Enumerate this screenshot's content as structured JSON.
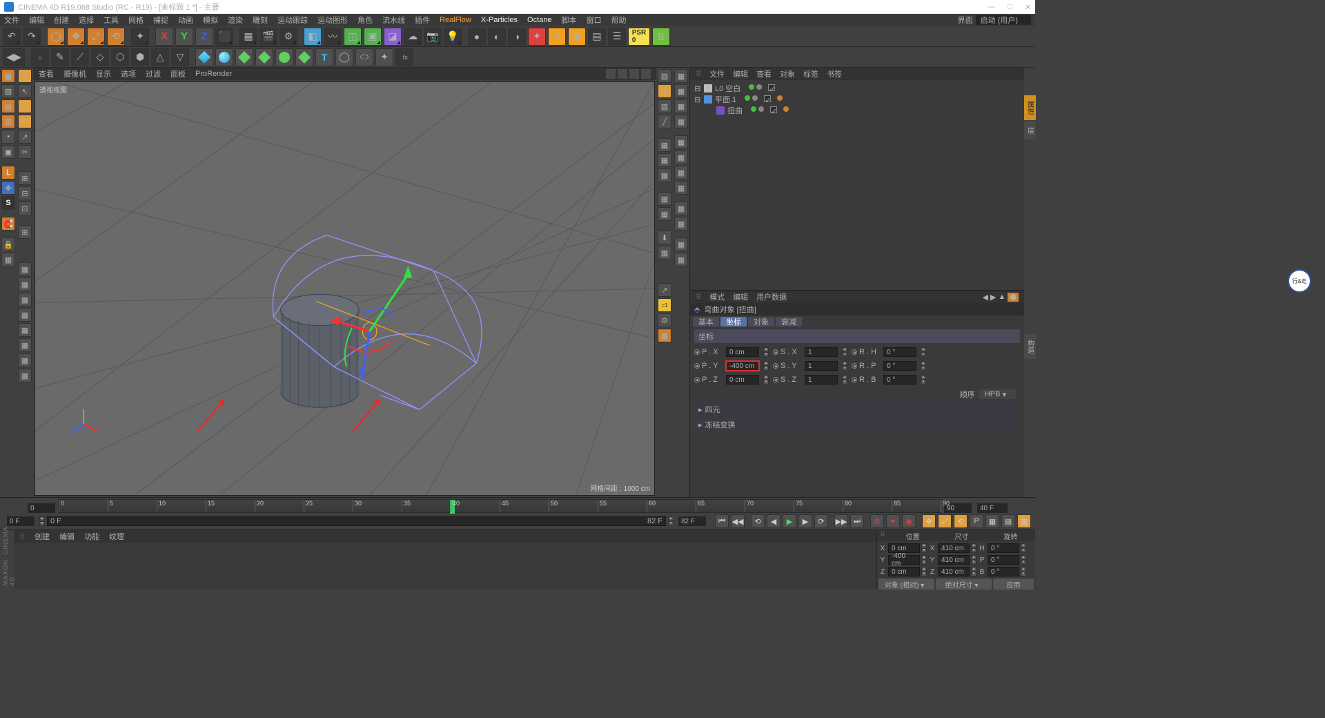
{
  "title": "CINEMA 4D R19.068 Studio (RC - R19) - [未标题 1 *] - 主要",
  "menus": [
    "文件",
    "编辑",
    "创建",
    "选择",
    "工具",
    "网格",
    "捕捉",
    "动画",
    "模拟",
    "渲染",
    "雕刻",
    "运动跟踪",
    "运动图形",
    "角色",
    "流水线",
    "插件",
    "RealFlow",
    "X-Particles",
    "Octane",
    "脚本",
    "窗口",
    "帮助"
  ],
  "layout_lbl": "界面",
  "layout_val": "启动 (用户)",
  "viewport": {
    "tabs": [
      "查看",
      "摄像机",
      "显示",
      "选项",
      "过滤",
      "面板",
      "ProRender"
    ],
    "label": "透视视图",
    "scale": "网格间距 : 1000 cm"
  },
  "objects": {
    "menus": [
      "文件",
      "编辑",
      "查看",
      "对象",
      "标签",
      "书签"
    ],
    "rows": [
      {
        "name": "L0 空白",
        "depth": 0,
        "icon": "null"
      },
      {
        "name": "平面.1",
        "depth": 0,
        "icon": "plane"
      },
      {
        "name": "扭曲",
        "depth": 1,
        "icon": "bend"
      }
    ]
  },
  "attr": {
    "menus": [
      "模式",
      "编辑",
      "用户数据"
    ],
    "title": "弯曲对象 [扭曲]",
    "tabs": [
      "基本",
      "坐标",
      "对象",
      "衰减"
    ],
    "active_tab": 1,
    "section": "坐标",
    "coords": {
      "px": {
        "l": "P . X",
        "v": "0 cm"
      },
      "py": {
        "l": "P . Y",
        "v": "-400 cm"
      },
      "pz": {
        "l": "P . Z",
        "v": "0 cm"
      },
      "sx": {
        "l": "S . X",
        "v": "1"
      },
      "sy": {
        "l": "S . Y",
        "v": "1"
      },
      "sz": {
        "l": "S . Z",
        "v": "1"
      },
      "rh": {
        "l": "R . H",
        "v": "0 °"
      },
      "rp": {
        "l": "R . P",
        "v": "0 °"
      },
      "rb": {
        "l": "R . B",
        "v": "0 °"
      }
    },
    "order_lbl": "顺序",
    "order_val": "HPB",
    "collapse": [
      "四元",
      "冻结变换"
    ]
  },
  "timeline": {
    "ticks": [
      "0",
      "5",
      "10",
      "15",
      "20",
      "25",
      "30",
      "35",
      "40",
      "45",
      "50",
      "55",
      "60",
      "65",
      "70",
      "75",
      "80",
      "85",
      "90"
    ],
    "head_pos": 44.4,
    "left_f": "0 F",
    "cur_in": "0 F",
    "range_end": "82 F",
    "right_f": "82 F",
    "far_right": "40 F"
  },
  "materials": {
    "menus": [
      "创建",
      "编辑",
      "功能",
      "纹理"
    ]
  },
  "coord_panel": {
    "hdrs": [
      "位置",
      "尺寸",
      "旋转"
    ],
    "rows": [
      {
        "a": "X",
        "p": "0 cm",
        "s": "410 cm",
        "r": "H",
        "rv": "0 °"
      },
      {
        "a": "Y",
        "p": "-400 cm",
        "s": "410 cm",
        "r": "P",
        "rv": "0 °"
      },
      {
        "a": "Z",
        "p": "0 cm",
        "s": "410 cm",
        "r": "B",
        "rv": "0 °"
      }
    ],
    "combo1": "对象 (相对)",
    "combo2": "绝对尺寸",
    "apply": "应用"
  }
}
